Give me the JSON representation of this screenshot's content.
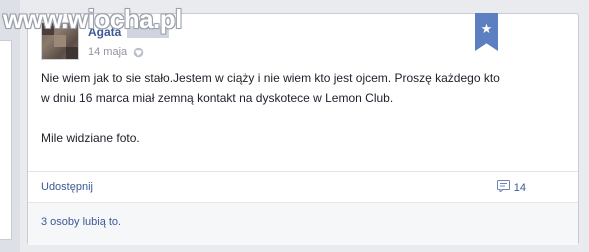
{
  "watermark": "www.wiocha.pl",
  "post": {
    "author": "Agata",
    "date": "14 maja",
    "privacy_icon": "globe-icon",
    "ribbon_icon": "star-icon",
    "paragraphs": [
      "Nie wiem jak to sie stało.Jestem w ciąży i nie wiem kto jest ojcem. Proszę każdego kto w dniu 16 marca miał zemną kontakt na dyskotece w Lemon Club.",
      "Mile widziane foto."
    ],
    "share_label": "Udostępnij",
    "comment_icon": "comment-icon",
    "comment_count": "14",
    "likes_text": "3 osoby lubią to."
  },
  "colors": {
    "link": "#3b5998",
    "ribbon": "#5b7fc0",
    "meta": "#90949c"
  }
}
